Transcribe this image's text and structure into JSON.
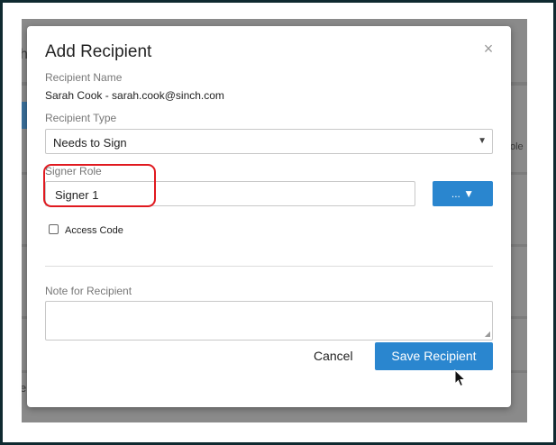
{
  "background": {
    "left_fragment_top": "h",
    "right_fragment": "ole",
    "left_fragment_bottom": "e"
  },
  "modal": {
    "title": "Add Recipient",
    "close_glyph": "×",
    "recipient_name": {
      "label": "Recipient Name",
      "value": "Sarah Cook - sarah.cook@sinch.com"
    },
    "recipient_type": {
      "label": "Recipient Type",
      "selected": "Needs to Sign",
      "caret": "▼"
    },
    "signer_role": {
      "label": "Signer Role",
      "value": "Signer 1",
      "button_label": "... ▼"
    },
    "access_code": {
      "label": "Access Code",
      "checked": false
    },
    "note": {
      "label": "Note for Recipient",
      "value": ""
    },
    "buttons": {
      "cancel": "Cancel",
      "save": "Save Recipient"
    }
  },
  "icons": {
    "close": "close-icon",
    "dropdown": "chevron-down-icon",
    "resize": "resize-grip-icon",
    "cursor": "mouse-pointer-icon"
  },
  "colors": {
    "primary_button": "#2a86cf",
    "highlight_ring": "#e0191f",
    "backdrop": "#8a8a8a"
  }
}
